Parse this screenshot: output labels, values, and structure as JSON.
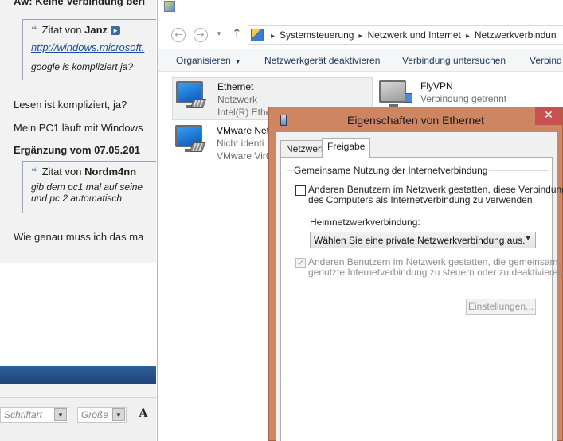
{
  "forum": {
    "post_title": "Aw: Keine Verbindung beri",
    "quote1": {
      "prefix": "Zitat von",
      "author": "Janz",
      "link": "http://windows.microsoft.",
      "text": "google is kompliziert ja?"
    },
    "line1": "Lesen ist kompliziert, ja?",
    "line2": "Mein PC1 läuft mit Windows",
    "edit_note": "Ergänzung vom 07.05.201",
    "quote2": {
      "prefix": "Zitat von",
      "author": "Nordm4nn",
      "text_line1": "gib dem pc1 mal auf seine",
      "text_line2": "und pc 2 automatisch"
    },
    "line3": "Wie genau muss ich das ma",
    "toolbar": {
      "font_placeholder": "Schriftart",
      "size_placeholder": "Größe",
      "format_label": "A"
    }
  },
  "explorer": {
    "back_icon": "arrow-left-icon",
    "forward_icon": "arrow-right-icon",
    "up_icon": "arrow-up-icon",
    "breadcrumbs": [
      "Systemsteuerung",
      "Netzwerk und Internet",
      "Netzwerkverbindun"
    ],
    "commands": {
      "organize": "Organisieren",
      "disable": "Netzwerkgerät deaktivieren",
      "diagnose": "Verbindung untersuchen",
      "more": "Verbind"
    },
    "connections": [
      {
        "name": "Ethernet",
        "line1": "Netzwerk",
        "line2": "Intel(R) Ethe"
      },
      {
        "name": "FlyVPN",
        "line1": "Verbindung getrennt",
        "line2": ""
      },
      {
        "name": "VMware Net",
        "line1": "Nicht identi",
        "line2": "VMware Virt"
      }
    ]
  },
  "dialog": {
    "title": "Eigenschaften von Ethernet",
    "close_label": "✕",
    "tabs": [
      "Netzwerk",
      "Freigabe"
    ],
    "active_tab": "Freigabe",
    "group_title": "Gemeinsame Nutzung der Internetverbindung",
    "allow_share": {
      "line1": "Anderen Benutzern im Netzwerk gestatten, diese Verbindung",
      "line2": "des Computers als Internetverbindung zu verwenden",
      "checked": false
    },
    "home_network_label": "Heimnetzwerkverbindung:",
    "home_network_value": "Wählen Sie eine private Netzwerkverbindung aus.",
    "allow_control": {
      "line1": "Anderen Benutzern im Netzwerk gestatten, die gemeinsam",
      "line2": "genutzte Internetverbindung zu steuern oder zu deaktivieren",
      "checked": true
    },
    "settings_button": "Einstellungen...",
    "colors": {
      "title_bar": "#ce8562",
      "close": "#c75050"
    }
  }
}
